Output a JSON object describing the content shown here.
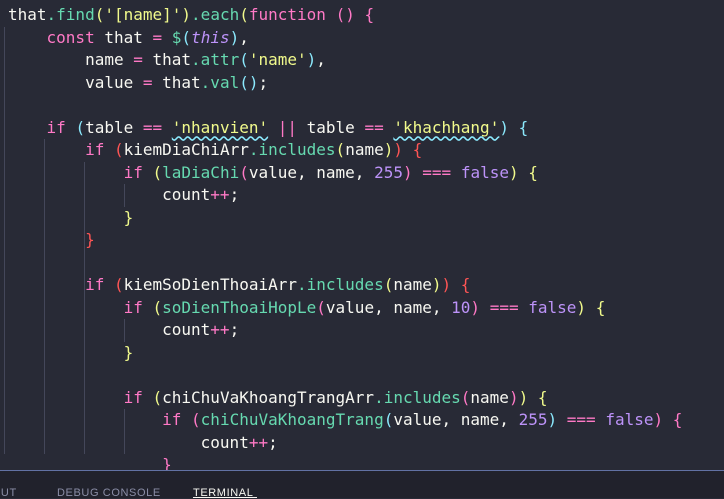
{
  "editor": {
    "lines": [
      [
        [
          "plain",
          "that"
        ],
        [
          "fn",
          ".find"
        ],
        [
          "b1",
          "("
        ],
        [
          "str",
          "'[name]'"
        ],
        [
          "b1",
          ")"
        ],
        [
          "fn",
          ".each"
        ],
        [
          "b1",
          "("
        ],
        [
          "kw",
          "function"
        ],
        [
          "plain",
          " "
        ],
        [
          "b2",
          "("
        ],
        [
          "b2",
          ")"
        ],
        [
          "plain",
          " "
        ],
        [
          "b2",
          "{"
        ]
      ],
      [
        [
          "plain",
          "    "
        ],
        [
          "kw",
          "const"
        ],
        [
          "plain",
          " that "
        ],
        [
          "op",
          "="
        ],
        [
          "plain",
          " "
        ],
        [
          "fn",
          "$"
        ],
        [
          "b3",
          "("
        ],
        [
          "this",
          "this"
        ],
        [
          "b3",
          ")"
        ],
        [
          "plain",
          ","
        ]
      ],
      [
        [
          "plain",
          "        name "
        ],
        [
          "op",
          "="
        ],
        [
          "plain",
          " that"
        ],
        [
          "fn",
          ".attr"
        ],
        [
          "b3",
          "("
        ],
        [
          "str",
          "'name'"
        ],
        [
          "b3",
          ")"
        ],
        [
          "plain",
          ","
        ]
      ],
      [
        [
          "plain",
          "        value "
        ],
        [
          "op",
          "="
        ],
        [
          "plain",
          " that"
        ],
        [
          "fn",
          ".val"
        ],
        [
          "b3",
          "("
        ],
        [
          "b3",
          ")"
        ],
        [
          "plain",
          ";"
        ]
      ],
      [],
      [
        [
          "plain",
          "    "
        ],
        [
          "kw",
          "if"
        ],
        [
          "plain",
          " "
        ],
        [
          "b3",
          "("
        ],
        [
          "plain",
          "table "
        ],
        [
          "op",
          "=="
        ],
        [
          "plain",
          " "
        ],
        [
          "str",
          "'nhanvien'"
        ],
        [
          "plain",
          " "
        ],
        [
          "op",
          "||"
        ],
        [
          "plain",
          " table "
        ],
        [
          "op",
          "=="
        ],
        [
          "plain",
          " "
        ],
        [
          "str",
          "'khachhang'"
        ],
        [
          "b3",
          ")"
        ],
        [
          "plain",
          " "
        ],
        [
          "b3",
          "{"
        ]
      ],
      [
        [
          "plain",
          "        "
        ],
        [
          "kw",
          "if"
        ],
        [
          "plain",
          " "
        ],
        [
          "b4",
          "("
        ],
        [
          "plain",
          "kiemDiaChiArr"
        ],
        [
          "fn",
          ".includes"
        ],
        [
          "b1",
          "("
        ],
        [
          "plain",
          "name"
        ],
        [
          "b1",
          ")"
        ],
        [
          "b4",
          ")"
        ],
        [
          "plain",
          " "
        ],
        [
          "b4",
          "{"
        ]
      ],
      [
        [
          "plain",
          "            "
        ],
        [
          "kw",
          "if"
        ],
        [
          "plain",
          " "
        ],
        [
          "b1",
          "("
        ],
        [
          "fn",
          "laDiaChi"
        ],
        [
          "b2",
          "("
        ],
        [
          "plain",
          "value, name, "
        ],
        [
          "num",
          "255"
        ],
        [
          "b2",
          ")"
        ],
        [
          "plain",
          " "
        ],
        [
          "op",
          "==="
        ],
        [
          "plain",
          " "
        ],
        [
          "con",
          "false"
        ],
        [
          "b1",
          ")"
        ],
        [
          "plain",
          " "
        ],
        [
          "b1",
          "{"
        ]
      ],
      [
        [
          "plain",
          "                count"
        ],
        [
          "op",
          "++"
        ],
        [
          "plain",
          ";"
        ]
      ],
      [
        [
          "plain",
          "            "
        ],
        [
          "b1",
          "}"
        ]
      ],
      [
        [
          "plain",
          "        "
        ],
        [
          "b4",
          "}"
        ]
      ],
      [],
      [
        [
          "plain",
          "        "
        ],
        [
          "kw",
          "if"
        ],
        [
          "plain",
          " "
        ],
        [
          "b4",
          "("
        ],
        [
          "plain",
          "kiemSoDienThoaiArr"
        ],
        [
          "fn",
          ".includes"
        ],
        [
          "b1",
          "("
        ],
        [
          "plain",
          "name"
        ],
        [
          "b1",
          ")"
        ],
        [
          "b4",
          ")"
        ],
        [
          "plain",
          " "
        ],
        [
          "b4",
          "{"
        ]
      ],
      [
        [
          "plain",
          "            "
        ],
        [
          "kw",
          "if"
        ],
        [
          "plain",
          " "
        ],
        [
          "b1",
          "("
        ],
        [
          "fn",
          "soDienThoaiHopLe"
        ],
        [
          "b2",
          "("
        ],
        [
          "plain",
          "value, name, "
        ],
        [
          "num",
          "10"
        ],
        [
          "b2",
          ")"
        ],
        [
          "plain",
          " "
        ],
        [
          "op",
          "==="
        ],
        [
          "plain",
          " "
        ],
        [
          "con",
          "false"
        ],
        [
          "b1",
          ")"
        ],
        [
          "plain",
          " "
        ],
        [
          "b1",
          "{"
        ]
      ],
      [
        [
          "plain",
          "                count"
        ],
        [
          "op",
          "++"
        ],
        [
          "plain",
          ";"
        ]
      ],
      [
        [
          "plain",
          "            "
        ],
        [
          "b1",
          "}"
        ]
      ],
      [],
      [
        [
          "plain",
          "            "
        ],
        [
          "kw",
          "if"
        ],
        [
          "plain",
          " "
        ],
        [
          "b1",
          "("
        ],
        [
          "plain",
          "chiChuVaKhoangTrangArr"
        ],
        [
          "fn",
          ".includes"
        ],
        [
          "b2",
          "("
        ],
        [
          "plain",
          "name"
        ],
        [
          "b2",
          ")"
        ],
        [
          "b1",
          ")"
        ],
        [
          "plain",
          " "
        ],
        [
          "b1",
          "{"
        ]
      ],
      [
        [
          "plain",
          "                "
        ],
        [
          "kw",
          "if"
        ],
        [
          "plain",
          " "
        ],
        [
          "b2",
          "("
        ],
        [
          "fn",
          "chiChuVaKhoangTrang"
        ],
        [
          "b3",
          "("
        ],
        [
          "plain",
          "value, name, "
        ],
        [
          "num",
          "255"
        ],
        [
          "b3",
          ")"
        ],
        [
          "plain",
          " "
        ],
        [
          "op",
          "==="
        ],
        [
          "plain",
          " "
        ],
        [
          "con",
          "false"
        ],
        [
          "b2",
          ")"
        ],
        [
          "plain",
          " "
        ],
        [
          "b2",
          "{"
        ]
      ],
      [
        [
          "plain",
          "                    count"
        ],
        [
          "op",
          "++"
        ],
        [
          "plain",
          ";"
        ]
      ],
      [
        [
          "plain",
          "                "
        ],
        [
          "b2",
          "}"
        ]
      ]
    ]
  },
  "panel": {
    "tabs": [
      {
        "label": "PUT",
        "active": false
      },
      {
        "label": "DEBUG CONSOLE",
        "active": false
      },
      {
        "label": "TERMINAL",
        "active": true
      }
    ]
  }
}
